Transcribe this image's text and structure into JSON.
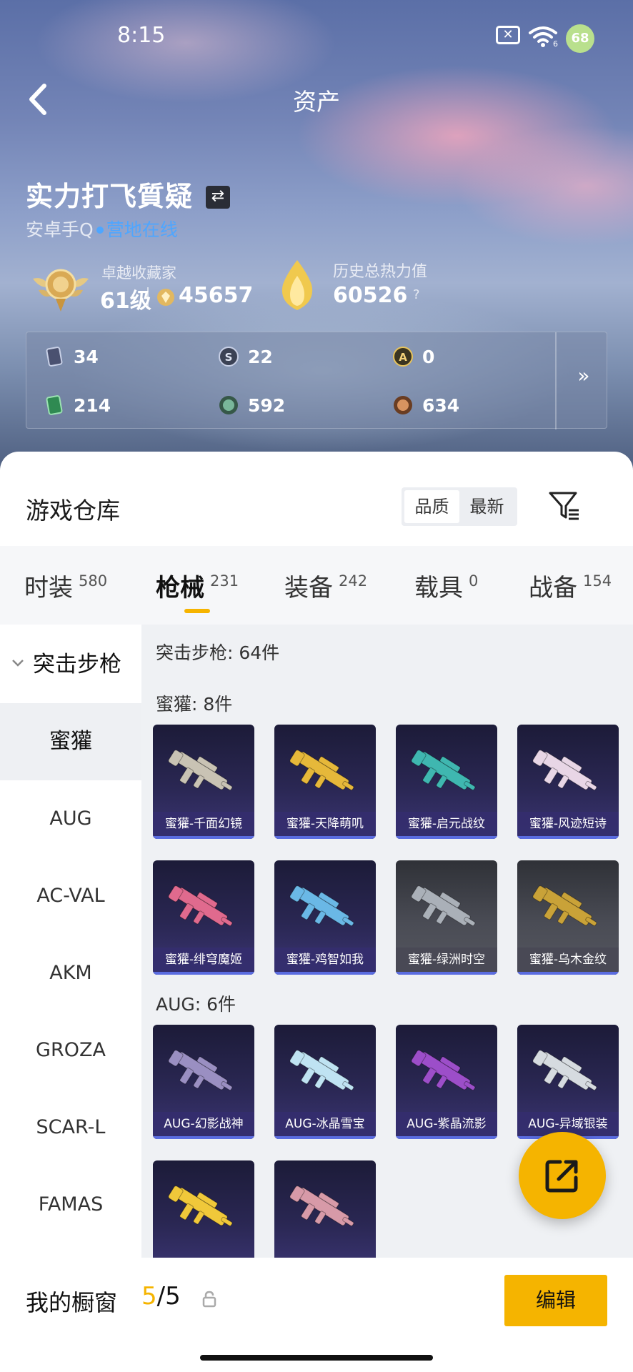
{
  "status_bar": {
    "time": "8:15",
    "battery": "68",
    "wifi_label": "6"
  },
  "nav": {
    "title": "资产"
  },
  "profile": {
    "name": "实力打飞質疑",
    "platform": "安卓手Q",
    "status": "营地在线",
    "rank_title": "卓越收藏家",
    "level": "61级",
    "coins": "45657",
    "heat_title": "历史总热力值",
    "heat_value": "60526",
    "help": "?"
  },
  "stats": [
    {
      "icon": "card-icon",
      "value": "34"
    },
    {
      "icon": "badge-s-icon",
      "value": "22"
    },
    {
      "icon": "badge-a-icon",
      "value": "0"
    },
    {
      "icon": "green-card-icon",
      "value": "214"
    },
    {
      "icon": "green-orb-icon",
      "value": "592"
    },
    {
      "icon": "bronze-orb-icon",
      "value": "634"
    }
  ],
  "warehouse": {
    "title": "游戏仓库",
    "sort_options": [
      "品质",
      "最新"
    ],
    "sort_selected": "品质"
  },
  "tabs": [
    {
      "label": "时装",
      "count": "580"
    },
    {
      "label": "枪械",
      "count": "231"
    },
    {
      "label": "装备",
      "count": "242"
    },
    {
      "label": "载具",
      "count": "0"
    },
    {
      "label": "战备",
      "count": "154"
    }
  ],
  "sidebar": {
    "header": "突击步枪",
    "items": [
      "蜜獾",
      "AUG",
      "AC-VAL",
      "AKM",
      "GROZA",
      "SCAR-L",
      "FAMAS"
    ],
    "selected": "蜜獾"
  },
  "content": {
    "category_label": "突击步枪: 64件",
    "groups": [
      {
        "label": "蜜獾: 8件",
        "items": [
          {
            "name": "蜜獾-千面幻镜",
            "color": "#c9c3b4",
            "tier": "purple"
          },
          {
            "name": "蜜獾-天降萌叽",
            "color": "#e6b83a",
            "tier": "purple"
          },
          {
            "name": "蜜獾-启元战纹",
            "color": "#3fb7b0",
            "tier": "purple"
          },
          {
            "name": "蜜獾-风迹短诗",
            "color": "#e8d6e6",
            "tier": "purple"
          },
          {
            "name": "蜜獾-绯穹魔姬",
            "color": "#e06a8e",
            "tier": "purple"
          },
          {
            "name": "蜜獾-鸡智如我",
            "color": "#6ab8e6",
            "tier": "purple"
          },
          {
            "name": "蜜獾-绿洲时空",
            "color": "#aab0b8",
            "tier": "gray"
          },
          {
            "name": "蜜獾-乌木金纹",
            "color": "#c9a238",
            "tier": "gray"
          }
        ]
      },
      {
        "label": "AUG: 6件",
        "items": [
          {
            "name": "AUG-幻影战神",
            "color": "#9a8fc2",
            "tier": "purple"
          },
          {
            "name": "AUG-冰晶雪宝",
            "color": "#bfe3f2",
            "tier": "purple"
          },
          {
            "name": "AUG-紫晶流影",
            "color": "#9c4ec9",
            "tier": "purple"
          },
          {
            "name": "AUG-异域银装",
            "color": "#d6dbe0",
            "tier": "purple"
          },
          {
            "name": "",
            "color": "#f0c83a",
            "tier": "purple"
          },
          {
            "name": "",
            "color": "#d79aa8",
            "tier": "purple"
          }
        ]
      }
    ]
  },
  "showcase": {
    "title": "我的橱窗",
    "current": "5",
    "total": "/5",
    "edit_label": "编辑"
  },
  "colors": {
    "accent": "#f5b400",
    "online": "#4ea6ff",
    "card_bg": "#2a2753"
  }
}
